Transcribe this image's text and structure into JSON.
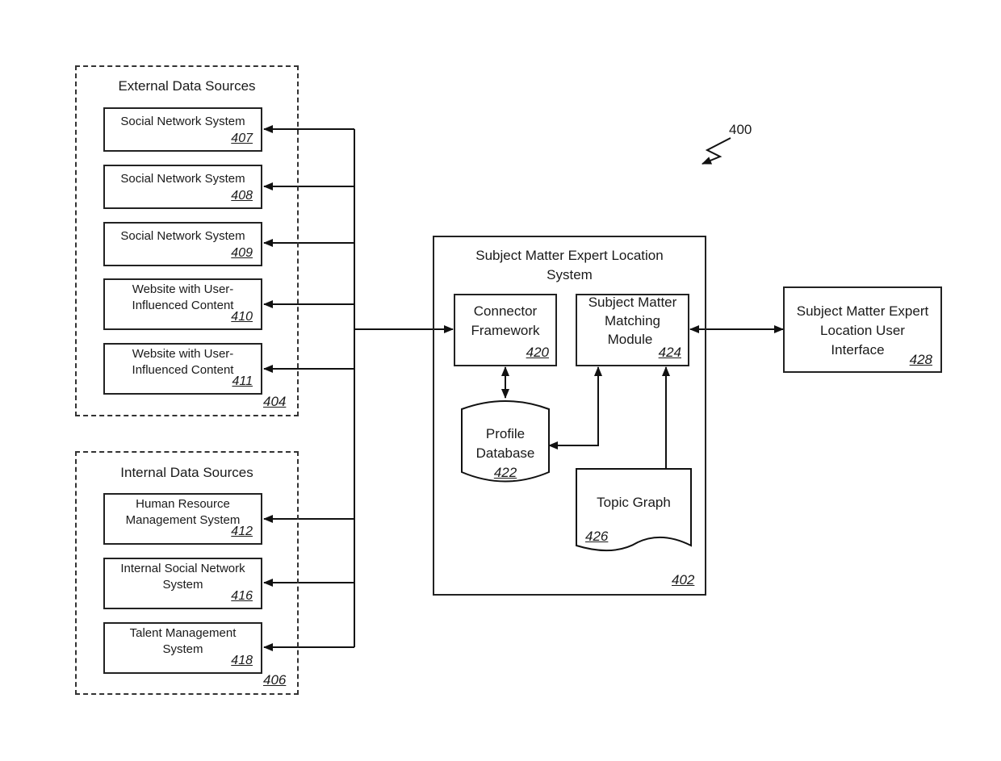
{
  "figure_ref": "400",
  "external_sources": {
    "title": "External Data Sources",
    "ref": "404",
    "items": [
      {
        "label_lines": [
          "Social Network System"
        ],
        "ref": "407"
      },
      {
        "label_lines": [
          "Social Network System"
        ],
        "ref": "408"
      },
      {
        "label_lines": [
          "Social Network System"
        ],
        "ref": "409"
      },
      {
        "label_lines": [
          "Website with User-",
          "Influenced Content"
        ],
        "ref": "410"
      },
      {
        "label_lines": [
          "Website with User-",
          "Influenced Content"
        ],
        "ref": "411"
      }
    ]
  },
  "internal_sources": {
    "title": "Internal Data Sources",
    "ref": "406",
    "items": [
      {
        "label_lines": [
          "Human Resource",
          "Management System"
        ],
        "ref": "412"
      },
      {
        "label_lines": [
          "Internal Social Network",
          "System"
        ],
        "ref": "416"
      },
      {
        "label_lines": [
          "Talent Management",
          "System"
        ],
        "ref": "418"
      }
    ]
  },
  "sme_system": {
    "title_lines": [
      "Subject Matter Expert Location",
      "System"
    ],
    "ref": "402",
    "connector": {
      "label_lines": [
        "Connector",
        "Framework"
      ],
      "ref": "420"
    },
    "matching": {
      "label_lines": [
        "Subject Matter",
        "Matching",
        "Module"
      ],
      "ref": "424"
    },
    "profile_db": {
      "label_lines": [
        "Profile",
        "Database"
      ],
      "ref": "422"
    },
    "topic_graph": {
      "label": "Topic Graph",
      "ref": "426"
    }
  },
  "ui": {
    "label_lines": [
      "Subject Matter Expert",
      "Location User",
      "Interface"
    ],
    "ref": "428"
  }
}
